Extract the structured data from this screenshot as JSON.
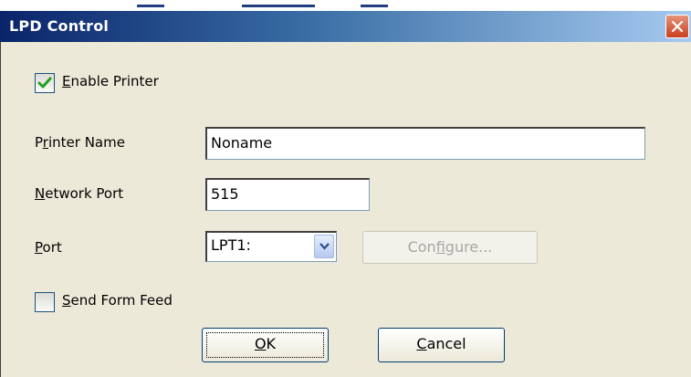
{
  "window": {
    "title": "LPD Control",
    "close_icon": "close-icon"
  },
  "colors": {
    "titlebar_start": "#0a246a",
    "titlebar_end": "#a6caf0",
    "dialog_bg": "#ece9d8",
    "close_button": "#c8401e",
    "check_green": "#21a121"
  },
  "enable_printer": {
    "checked": true,
    "label_mnemonic": "E",
    "label_rest": "nable Printer"
  },
  "printer_name": {
    "label_before": "P",
    "label_mnemonic": "r",
    "label_after": "inter Name",
    "value": "Noname"
  },
  "network_port": {
    "label_mnemonic": "N",
    "label_rest": "etwork Port",
    "value": "515"
  },
  "port": {
    "label_mnemonic": "P",
    "label_rest": "ort",
    "selected": "LPT1:",
    "dropdown_icon": "chevron-down-icon"
  },
  "configure_button": {
    "label_before": "Con",
    "label_mnemonic": "f",
    "label_after": "igure...",
    "enabled": false
  },
  "send_form_feed": {
    "checked": false,
    "label_mnemonic": "S",
    "label_rest": "end Form Feed"
  },
  "ok_button": {
    "label_mnemonic": "O",
    "label_rest": "K"
  },
  "cancel_button": {
    "label_mnemonic": "C",
    "label_rest": "ancel"
  }
}
